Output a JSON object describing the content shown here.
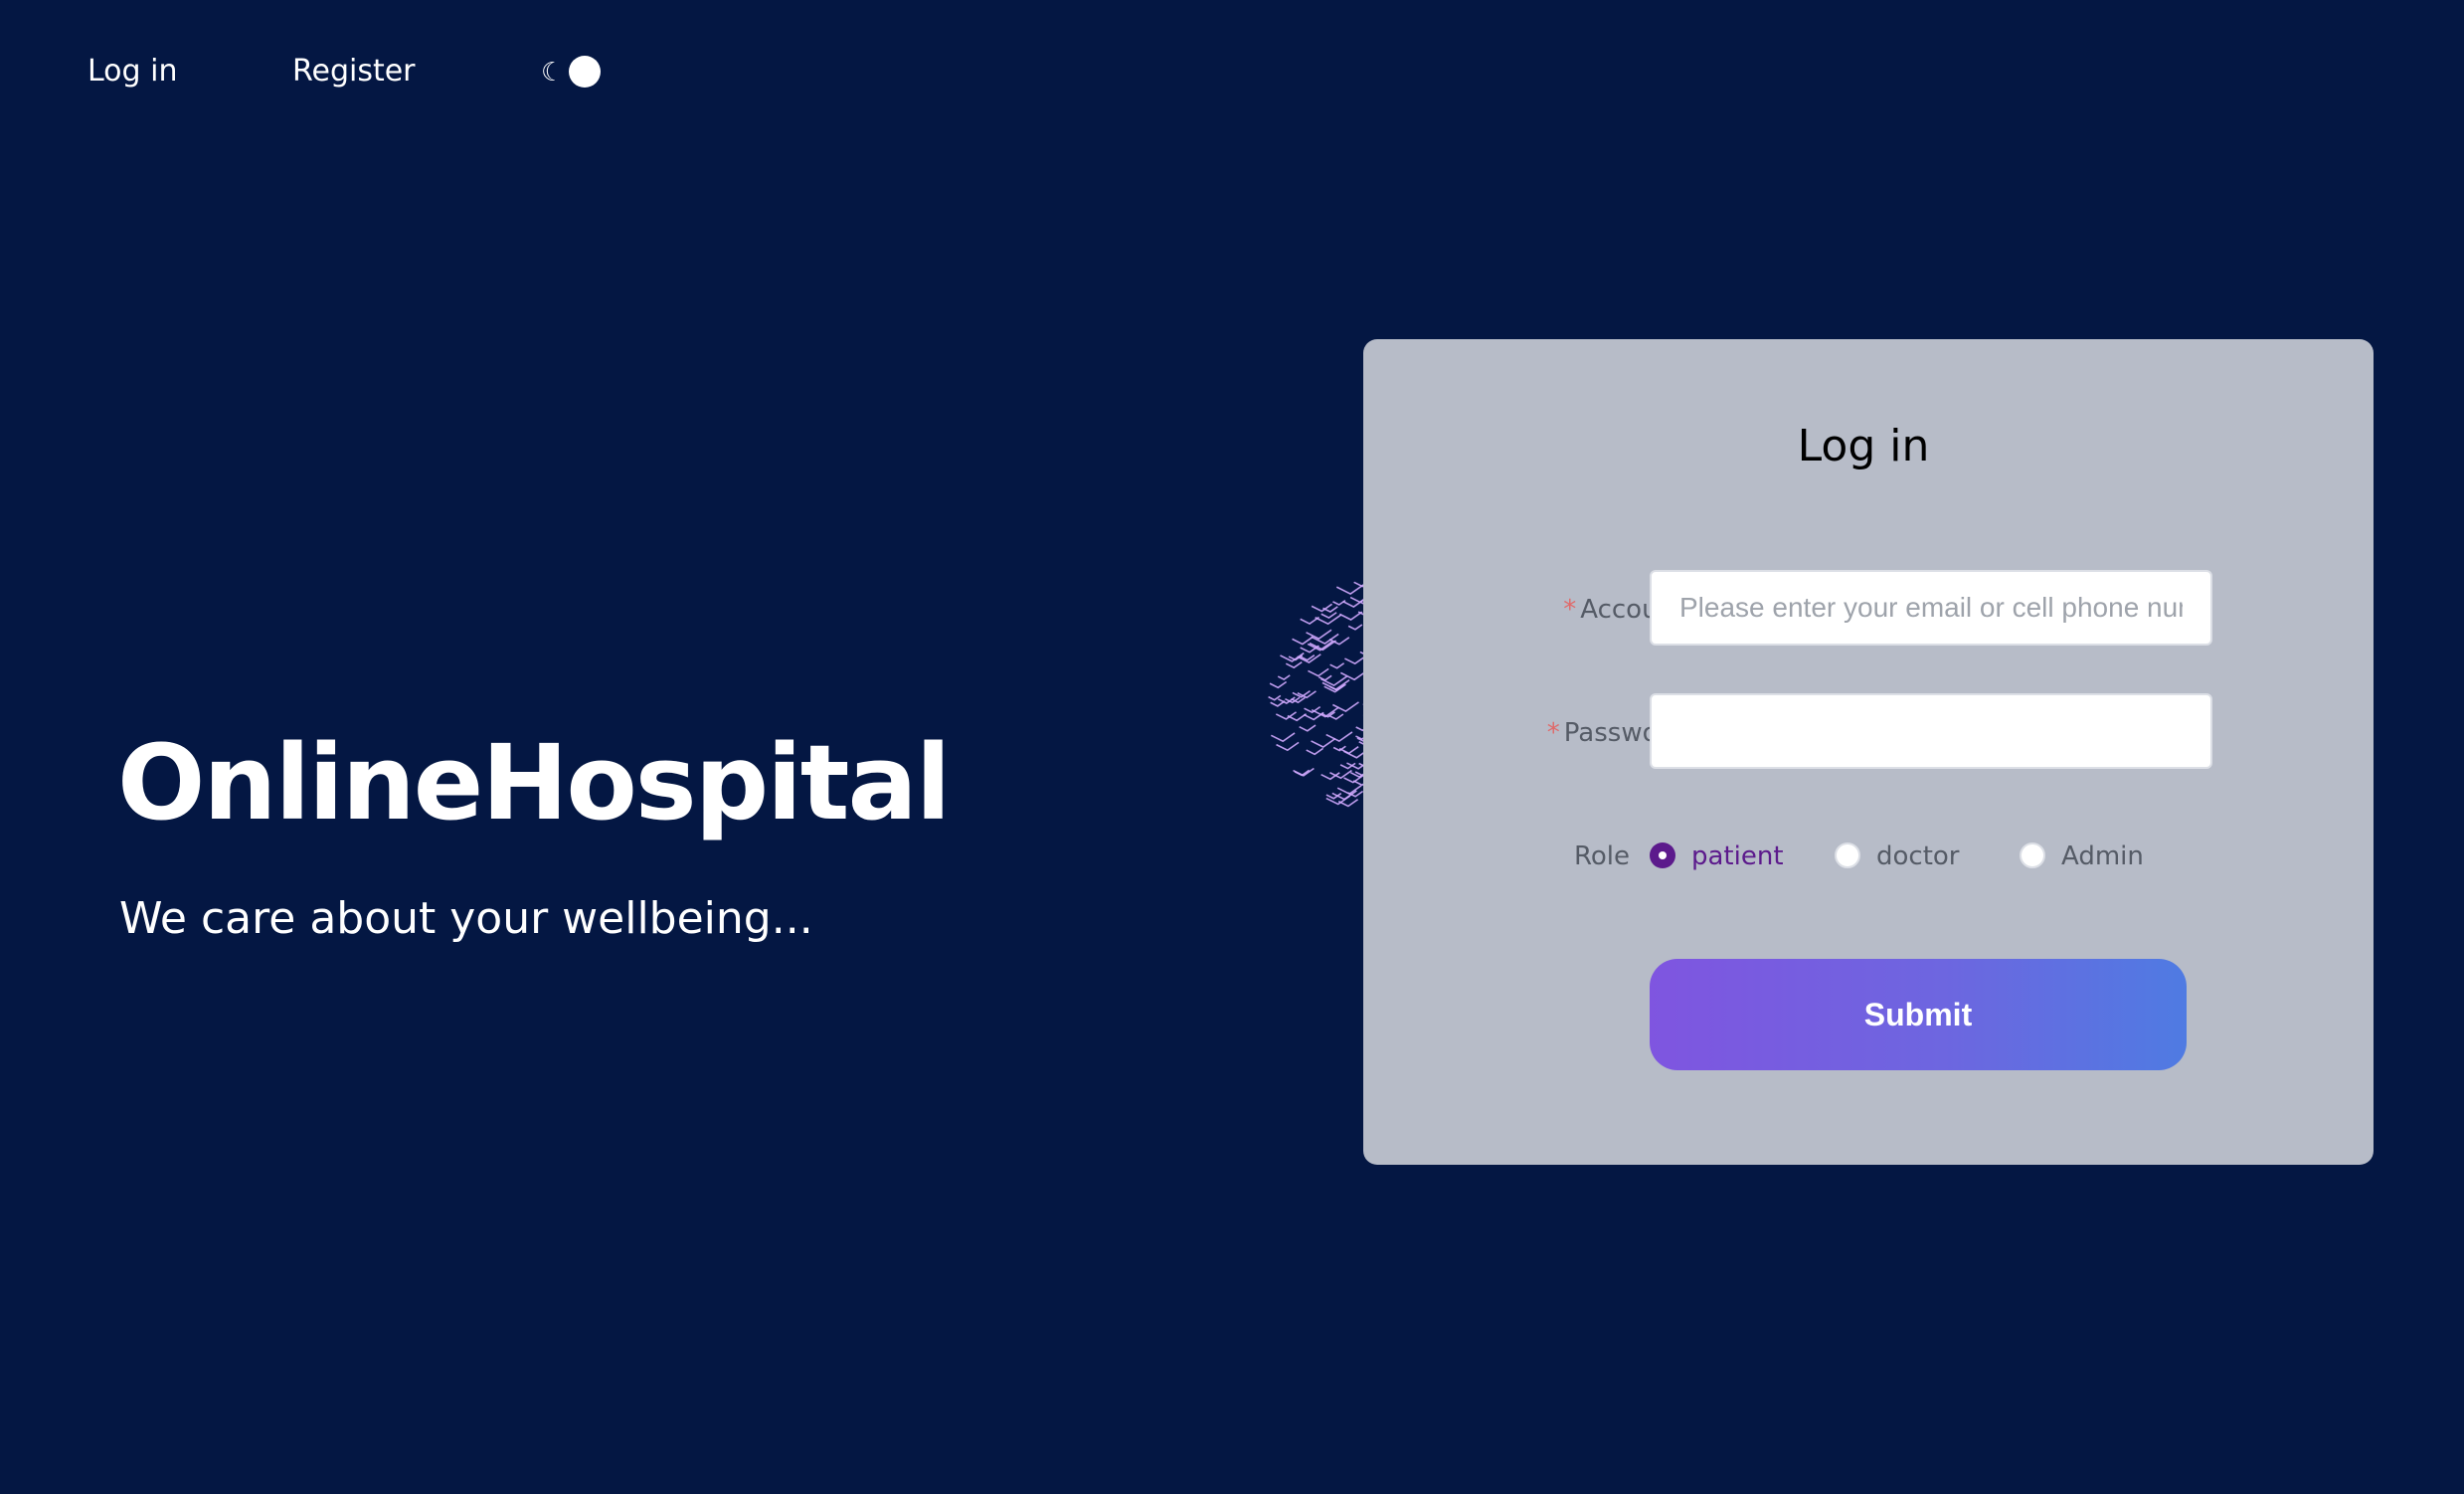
{
  "nav": {
    "login_label": "Log in",
    "register_label": "Register",
    "theme_moon_glyph": "☾",
    "theme_mode": "dark"
  },
  "hero": {
    "title": "OnlineHospital",
    "subtitle": "We care about your wellbeing..."
  },
  "login_form": {
    "title": "Log in",
    "account_label": "Account:",
    "account_value": "",
    "account_placeholder": "Please enter your email or cell phone number",
    "password_label": "Password:",
    "password_value": "",
    "required_marker": "*",
    "role_label": "Role",
    "roles": [
      {
        "label": "patient",
        "selected": true
      },
      {
        "label": "doctor",
        "selected": false
      },
      {
        "label": "Admin",
        "selected": false
      }
    ],
    "submit_label": "Submit"
  },
  "colors": {
    "background": "#041743",
    "card": "#b7bcc8",
    "accent": "#5c1a8c",
    "required": "#e06a6a",
    "button_gradient_start": "#7f55e0",
    "button_gradient_end": "#4f7be2"
  }
}
